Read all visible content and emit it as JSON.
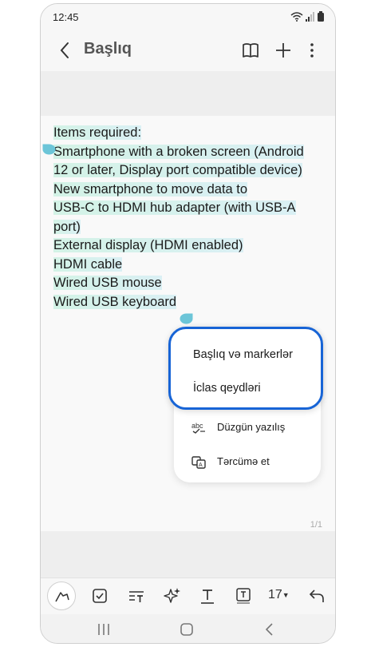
{
  "status": {
    "time": "12:45"
  },
  "appbar": {
    "title": "Başlıq"
  },
  "note": {
    "lines": [
      "Items required:",
      "Smartphone with a broken screen (Android",
      "12 or later, Display port compatible device)",
      "New smartphone to move data to",
      "USB-C to HDMI hub adapter (with USB-A",
      "port)",
      "External display (HDMI enabled)",
      "HDMI cable",
      "Wired USB mouse",
      "Wired USB keyboard"
    ],
    "page_indicator": "1/1"
  },
  "menu": {
    "highlighted_items": [
      "Başlıq və markerlər",
      "İclas qeydləri"
    ],
    "items": [
      {
        "label": "Düzgün yazılış",
        "icon": "spell-check-icon"
      },
      {
        "label": "Tərcümə et",
        "icon": "translate-icon"
      }
    ]
  },
  "toolbar": {
    "font_size": "17"
  }
}
